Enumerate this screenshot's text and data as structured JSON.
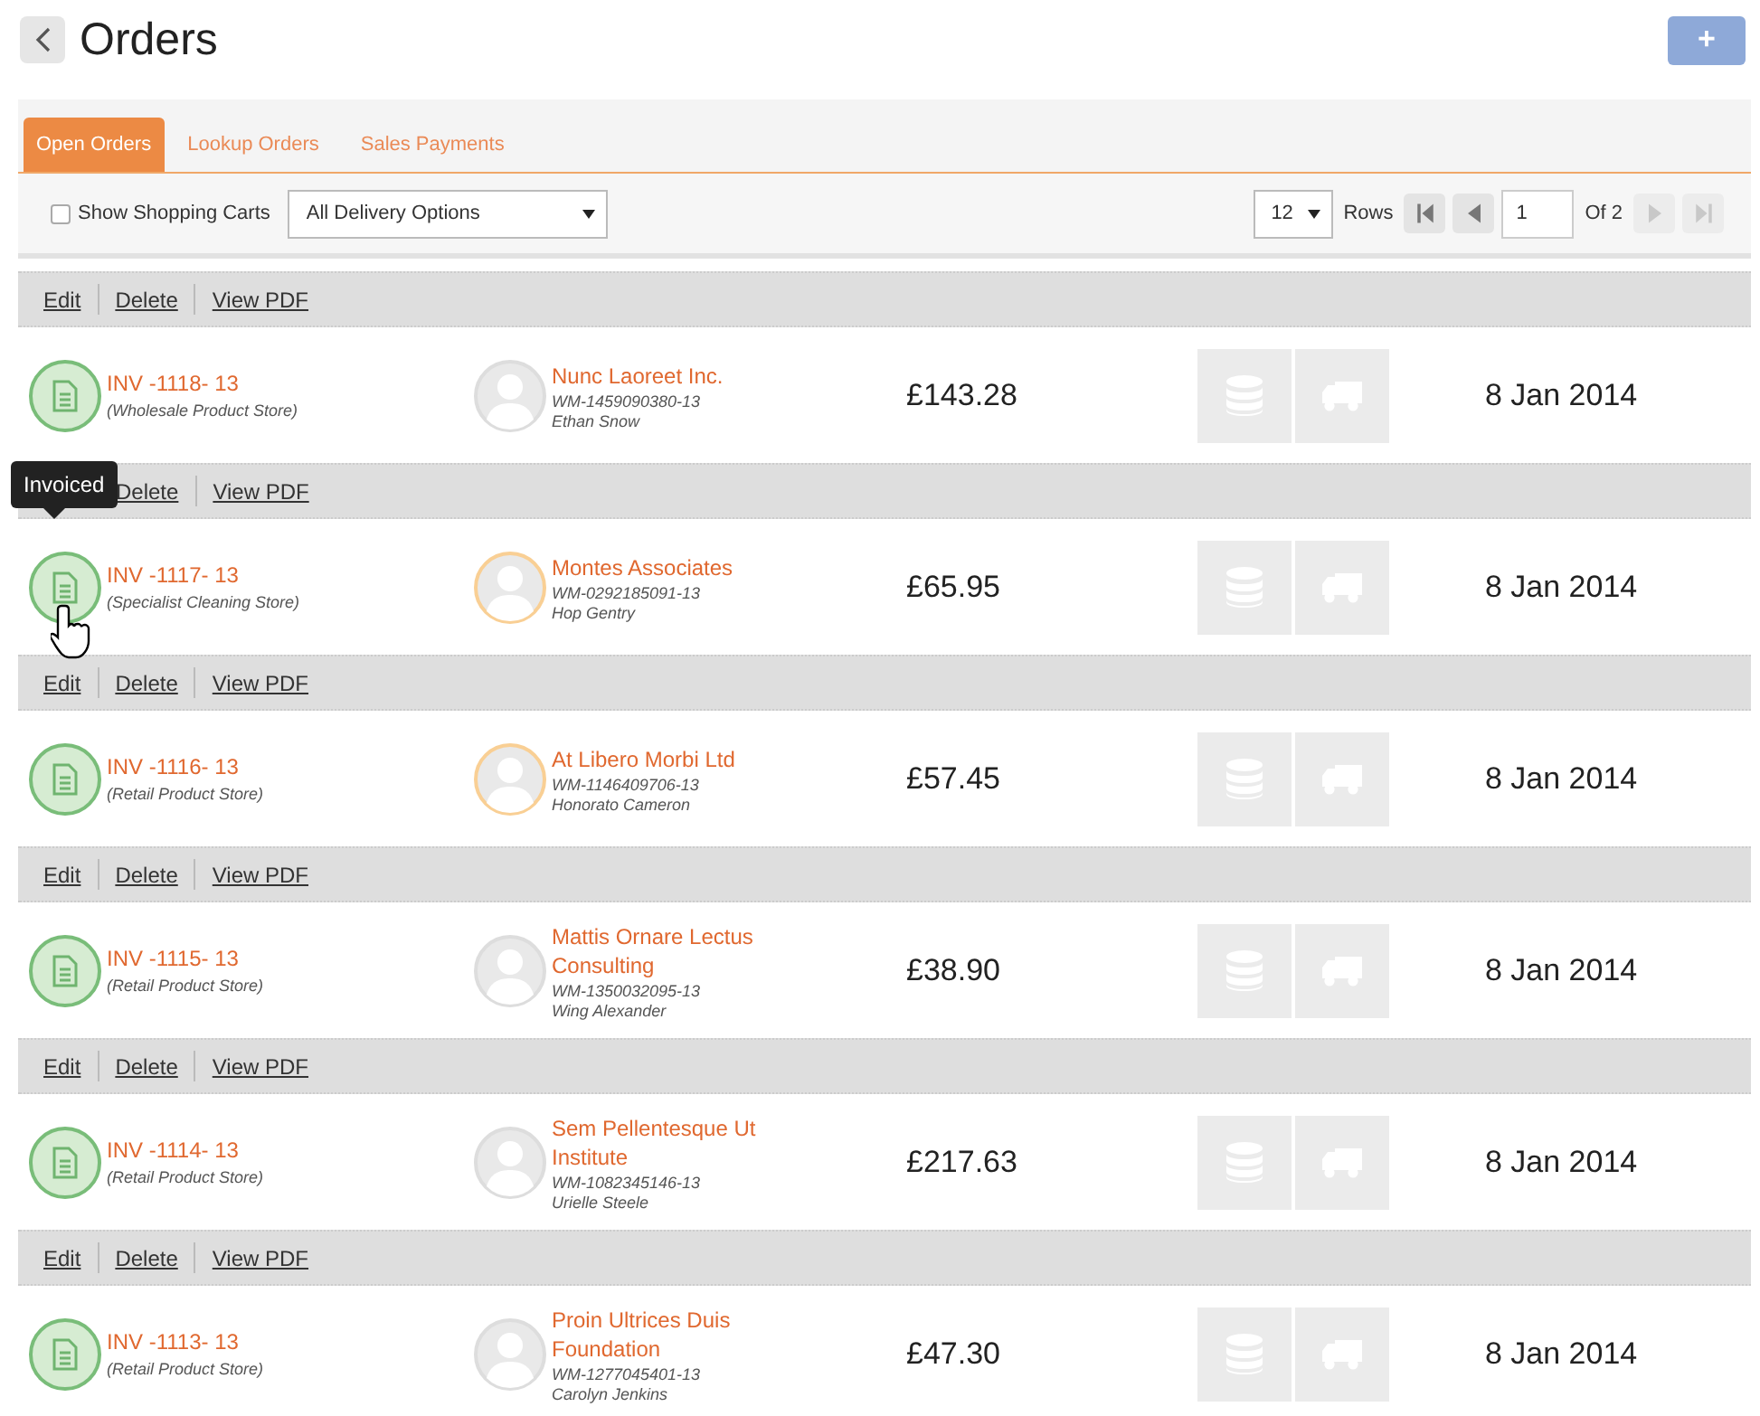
{
  "header": {
    "title": "Orders",
    "add_button": "+"
  },
  "tabs": [
    {
      "label": "Open Orders",
      "selected": true
    },
    {
      "label": "Lookup Orders",
      "selected": false
    },
    {
      "label": "Sales Payments",
      "selected": false
    }
  ],
  "toolbar": {
    "show_shopping_carts": {
      "label": "Show Shopping Carts",
      "checked": false
    },
    "delivery_filter": "All Delivery Options",
    "rows_per_page": "12",
    "rows_label": "Rows",
    "page": "1",
    "of_pages": "Of 2",
    "pager_buttons": [
      {
        "kind": "first",
        "disabled": false
      },
      {
        "kind": "prev",
        "disabled": false
      },
      {
        "kind": "next",
        "disabled": true
      },
      {
        "kind": "last",
        "disabled": true
      }
    ]
  },
  "orders": [
    {
      "actions": [
        "Edit",
        "Delete",
        "View PDF"
      ],
      "invoice": "INV -1118- 13",
      "store": "(Wholesale Product Store)",
      "customer": "Nunc Laoreet Inc.",
      "account": "WM-1459090380-13",
      "contact": "Ethan Snow",
      "avatar_highlighted": false,
      "amount": "£143.28",
      "date": "8 Jan 2014"
    },
    {
      "actions": [
        "Delete",
        "View PDF"
      ],
      "tooltip": "Invoiced",
      "invoice": "INV -1117- 13",
      "store": "(Specialist Cleaning Store)",
      "customer": "Montes Associates",
      "account": "WM-0292185091-13",
      "contact": "Hop Gentry",
      "avatar_highlighted": true,
      "amount": "£65.95",
      "date": "8 Jan 2014"
    },
    {
      "actions": [
        "Edit",
        "Delete",
        "View PDF"
      ],
      "invoice": "INV -1116- 13",
      "store": "(Retail Product Store)",
      "customer": "At Libero Morbi Ltd",
      "account": "WM-1146409706-13",
      "contact": "Honorato Cameron",
      "avatar_highlighted": true,
      "amount": "£57.45",
      "date": "8 Jan 2014"
    },
    {
      "actions": [
        "Edit",
        "Delete",
        "View PDF"
      ],
      "invoice": "INV -1115- 13",
      "store": "(Retail Product Store)",
      "customer": "Mattis Ornare Lectus Consulting",
      "account": "WM-1350032095-13",
      "contact": "Wing Alexander",
      "avatar_highlighted": false,
      "amount": "£38.90",
      "date": "8 Jan 2014"
    },
    {
      "actions": [
        "Edit",
        "Delete",
        "View PDF"
      ],
      "invoice": "INV -1114- 13",
      "store": "(Retail Product Store)",
      "customer": "Sem Pellentesque Ut Institute",
      "account": "WM-1082345146-13",
      "contact": "Urielle Steele",
      "avatar_highlighted": false,
      "amount": "£217.63",
      "date": "8 Jan 2014"
    },
    {
      "actions": [
        "Edit",
        "Delete",
        "View PDF"
      ],
      "invoice": "INV -1113- 13",
      "store": "(Retail Product Store)",
      "customer": "Proin Ultrices Duis Foundation",
      "account": "WM-1277045401-13",
      "contact": "Carolyn Jenkins",
      "avatar_highlighted": false,
      "amount": "£47.30",
      "date": "8 Jan 2014"
    }
  ]
}
